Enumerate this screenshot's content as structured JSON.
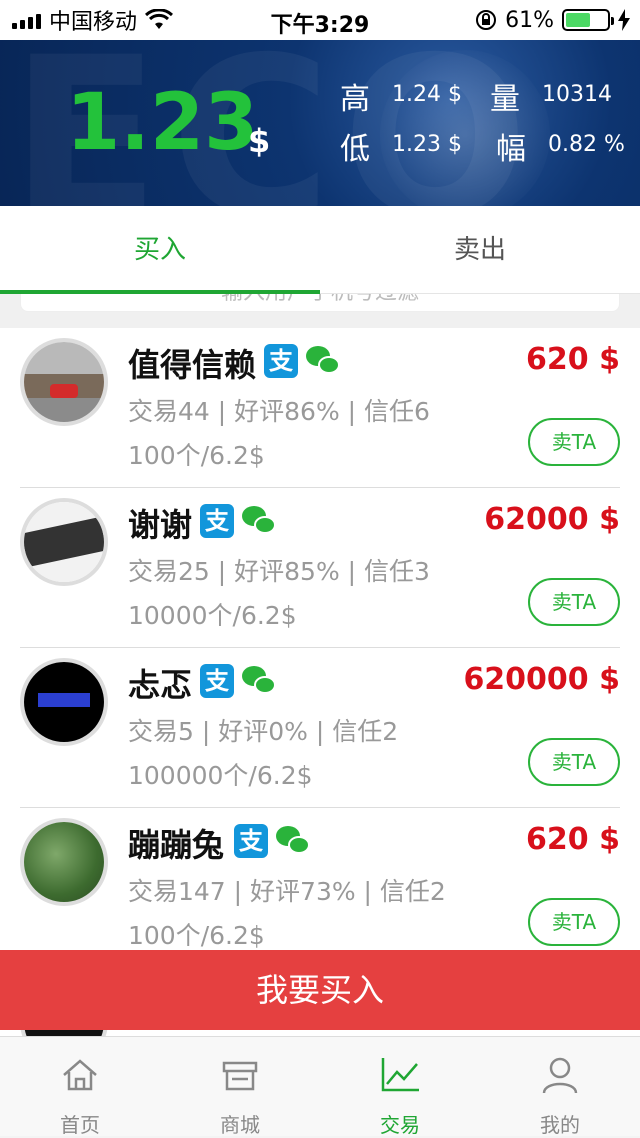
{
  "status_bar": {
    "carrier": "中国移动",
    "time": "下午3:29",
    "battery": "61%",
    "battery_level": 0.61
  },
  "header": {
    "price": "1.23",
    "currency": "$",
    "high_label": "高",
    "high_value": "1.24 $",
    "low_label": "低",
    "low_value": "1.23 $",
    "volume_label": "量",
    "volume_value": "10314",
    "change_label": "幅",
    "change_value": "0.82 %"
  },
  "tabs": [
    {
      "label": "买入",
      "active": true
    },
    {
      "label": "卖出",
      "active": false
    }
  ],
  "search": {
    "placeholder": "输入用户手机号过滤"
  },
  "listings": [
    {
      "name": "值得信赖",
      "stats": "交易44 | 好评86% | 信任6",
      "unit": "100个/6.2$",
      "price": "620 $",
      "action": "卖TA"
    },
    {
      "name": "谢谢",
      "stats": "交易25 | 好评85% | 信任3",
      "unit": "10000个/6.2$",
      "price": "62000 $",
      "action": "卖TA"
    },
    {
      "name": "忐忑",
      "stats": "交易5 | 好评0% | 信任2",
      "unit": "100000个/6.2$",
      "price": "620000 $",
      "action": "卖TA"
    },
    {
      "name": "蹦蹦兔",
      "stats": "交易147 | 好评73% | 信任2",
      "unit": "100个/6.2$",
      "price": "620 $",
      "action": "卖TA"
    }
  ],
  "buy_button": "我要买入",
  "nav": [
    {
      "label": "首页",
      "icon": "home-icon",
      "active": false
    },
    {
      "label": "商城",
      "icon": "store-icon",
      "active": false
    },
    {
      "label": "交易",
      "icon": "chart-icon",
      "active": true
    },
    {
      "label": "我的",
      "icon": "profile-icon",
      "active": false
    }
  ],
  "colors": {
    "accent_green": "#1fa633",
    "price_red": "#d8101b",
    "buy_button": "#e54040",
    "header_blue": "#0d3470"
  }
}
